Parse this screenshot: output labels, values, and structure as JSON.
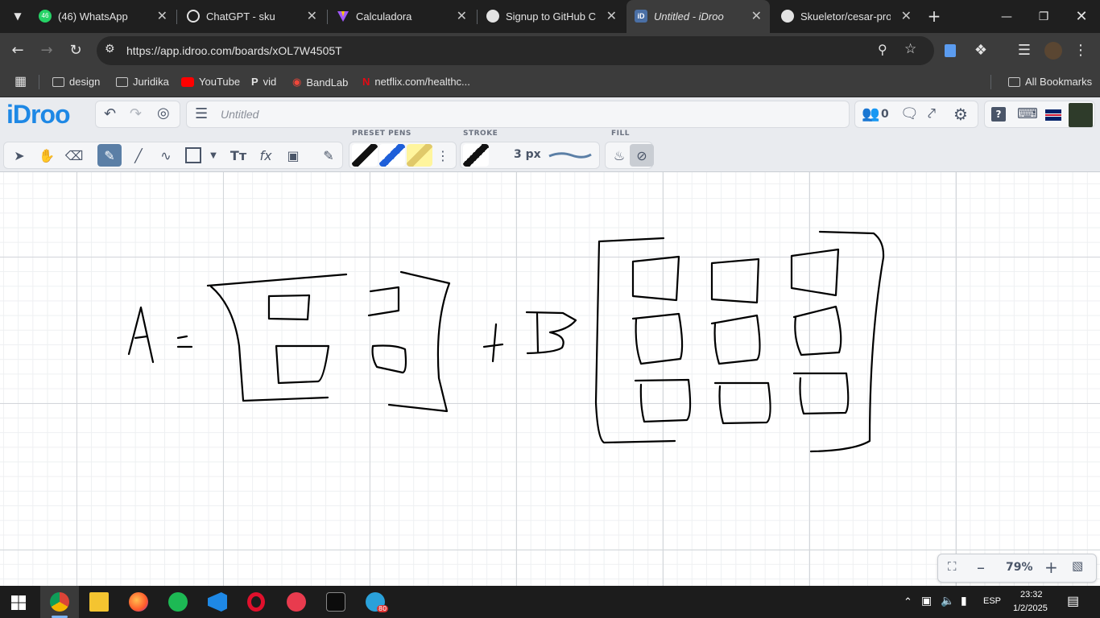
{
  "browser": {
    "tabs": [
      {
        "title": "(46) WhatsApp",
        "badge": "46"
      },
      {
        "title": "ChatGPT - sku"
      },
      {
        "title": "Calculadora"
      },
      {
        "title": "Signup to GitHub Co"
      },
      {
        "title": "Untitled - iDroo",
        "active": true
      },
      {
        "title": "Skueletor/cesar-proje"
      }
    ],
    "url": "https://app.idroo.com/boards/xOL7W4505T",
    "bookmarks": [
      "design",
      "Juridika",
      "YouTube",
      "vid",
      "BandLab",
      "netflix.com/healthc..."
    ],
    "all_bookmarks": "All Bookmarks"
  },
  "app": {
    "logo": "iDroo",
    "board_title_placeholder": "Untitled",
    "users_count": "0",
    "labels": {
      "preset_pens": "PRESET PENS",
      "stroke": "STROKE",
      "fill": "FILL"
    },
    "stroke_width": "3 px",
    "zoom": "79%",
    "colors": {
      "accent": "#1e88e5",
      "selected_tool": "#5b7fa6"
    }
  },
  "drawing": {
    "text_marks": [
      "A",
      "=",
      "+",
      "B"
    ]
  },
  "taskbar": {
    "language": "ESP",
    "time": "23:32",
    "date": "1/2/2025",
    "telegram_badge": "80"
  }
}
